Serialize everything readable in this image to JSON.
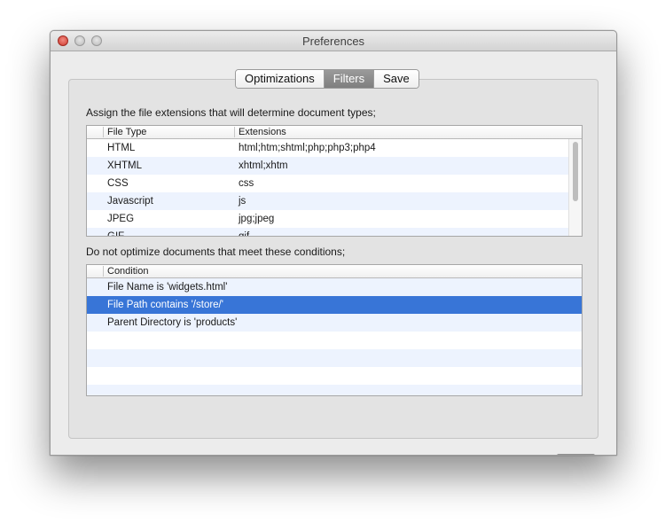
{
  "window": {
    "title": "Preferences"
  },
  "tabs": [
    {
      "label": "Optimizations",
      "active": false
    },
    {
      "label": "Filters",
      "active": true
    },
    {
      "label": "Save",
      "active": false
    }
  ],
  "extensions_section": {
    "label": "Assign the file extensions that will determine document types;",
    "columns": [
      "File Type",
      "Extensions"
    ],
    "rows": [
      {
        "type": "HTML",
        "ext": "html;htm;shtml;php;php3;php4"
      },
      {
        "type": "XHTML",
        "ext": "xhtml;xhtm"
      },
      {
        "type": "CSS",
        "ext": "css"
      },
      {
        "type": "Javascript",
        "ext": "js"
      },
      {
        "type": "JPEG",
        "ext": "jpg;jpeg"
      },
      {
        "type": "GIF",
        "ext": "gif"
      }
    ]
  },
  "conditions_section": {
    "label": "Do not optimize documents that meet these conditions;",
    "column": "Condition",
    "rows": [
      {
        "text": "File Name is 'widgets.html'",
        "selected": false
      },
      {
        "text": "File Path contains '/store/'",
        "selected": true
      },
      {
        "text": "Parent Directory is 'products'",
        "selected": false
      }
    ]
  },
  "buttons": {
    "add": "+",
    "remove": "−"
  },
  "colors": {
    "selection": "#3875d7",
    "row_alt": "#edf3fe",
    "close_light": "#e0443a"
  }
}
